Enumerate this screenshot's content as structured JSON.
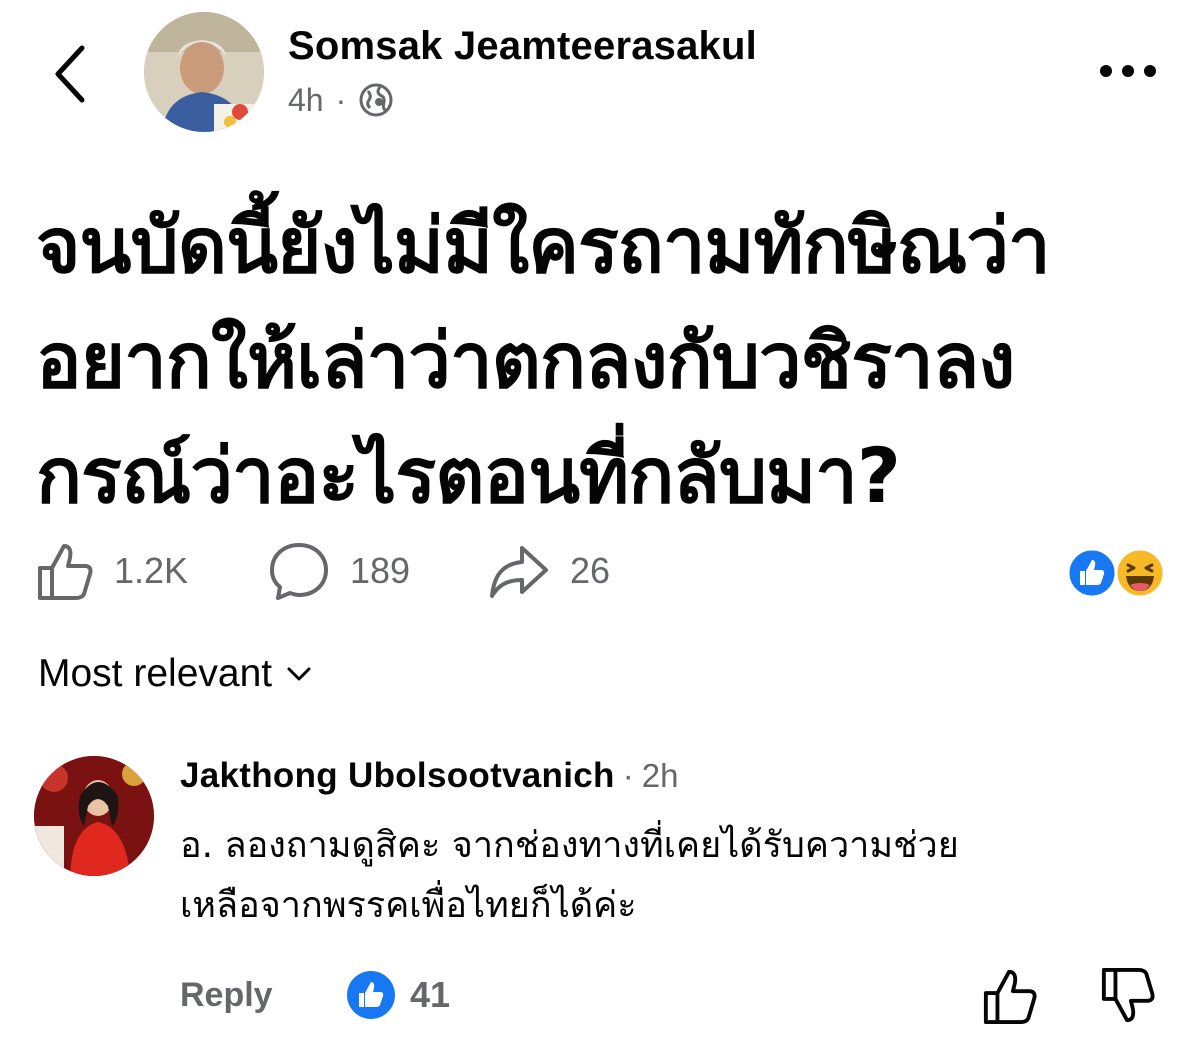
{
  "header": {
    "author": "Somsak Jeamteerasakul",
    "time": "4h",
    "separator": "·",
    "audience_icon": "globe-icon",
    "more_icon": "more-horizontal-icon"
  },
  "post": {
    "lines": [
      "จนบัดนี้ยังไม่มีใครถามทักษิณว่า",
      "อยากให้เล่าว่าตกลงกับวชิราลง",
      "กรณ์ว่าอะไรตอนที่กลับมา?"
    ]
  },
  "actions": {
    "likes": "1.2K",
    "comments": "189",
    "shares": "26"
  },
  "reactions": [
    "like",
    "haha"
  ],
  "sort": {
    "label": "Most relevant"
  },
  "comment": {
    "author": "Jakthong Ubolsootvanich",
    "time": "2h",
    "separator": "·",
    "lines": [
      "อ. ลองถามดูสิคะ จากช่องทางที่เคยได้รับความช่วย",
      "เหลือจากพรรคเพื่อไทยก็ได้ค่ะ"
    ],
    "reply_label": "Reply",
    "like_count": "41"
  },
  "colors": {
    "text": "#050505",
    "secondary": "#65676b",
    "like_blue": "#1877f2",
    "haha_yellow": "#f7b928"
  }
}
